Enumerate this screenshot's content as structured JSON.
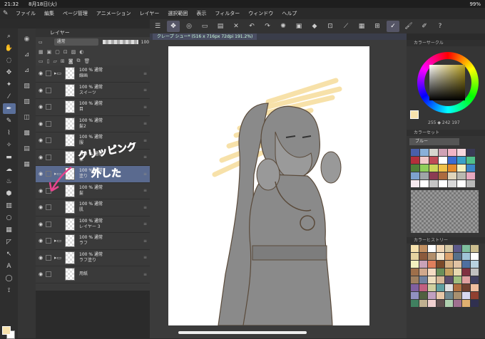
{
  "status": {
    "time": "21:32",
    "date": "8月18日(火)",
    "battery": "99%"
  },
  "menu": [
    "ファイル",
    "編集",
    "ページ管理",
    "アニメーション",
    "レイヤー",
    "選択範囲",
    "表示",
    "フィルター",
    "ウィンドウ",
    "ヘルプ"
  ],
  "tab": {
    "label": "クレープ シュー* (516 x 716px 72dpi 191.2%)"
  },
  "layer_panel": {
    "title": "レイヤー",
    "blend_mode": "通常",
    "opacity": "100",
    "layers": [
      {
        "top": "100 % 通常",
        "name": "線画",
        "folder": true,
        "selected": false
      },
      {
        "top": "100 % 通常",
        "name": "スイーツ",
        "folder": false,
        "selected": false
      },
      {
        "top": "100 % 通常",
        "name": "目",
        "folder": false,
        "selected": false
      },
      {
        "top": "100 % 通常",
        "name": "髪2",
        "folder": false,
        "selected": false
      },
      {
        "top": "100 % 通常",
        "name": "服",
        "folder": false,
        "selected": false
      },
      {
        "top": "100 % 通常",
        "name": "体",
        "folder": false,
        "selected": false
      },
      {
        "top": "100 % 通常",
        "name": "塗り",
        "folder": true,
        "selected": true
      },
      {
        "top": "100 % 通常",
        "name": "髪",
        "folder": false,
        "selected": false
      },
      {
        "top": "100 % 通常",
        "name": "肌",
        "folder": false,
        "selected": false
      },
      {
        "top": "100 % 通常",
        "name": "レイヤー 3",
        "folder": false,
        "selected": false
      },
      {
        "top": "100 % 通常",
        "name": "ラフ",
        "folder": true,
        "selected": false
      },
      {
        "top": "100 % 通常",
        "name": "ラフ塗り",
        "folder": true,
        "selected": false
      },
      {
        "top": "",
        "name": "用紙",
        "folder": false,
        "selected": false
      }
    ]
  },
  "annotation": {
    "line1": "クリッピング",
    "line2": "外した",
    "color": "#e8458f"
  },
  "color_wheel": {
    "title": "カラーサークル",
    "readout": "255 ◆ 242 197",
    "current_color": "#f7e2ad"
  },
  "color_set": {
    "title": "カラーセット",
    "selected": "ブルー"
  },
  "color_history": {
    "title": "カラーヒストリー"
  }
}
